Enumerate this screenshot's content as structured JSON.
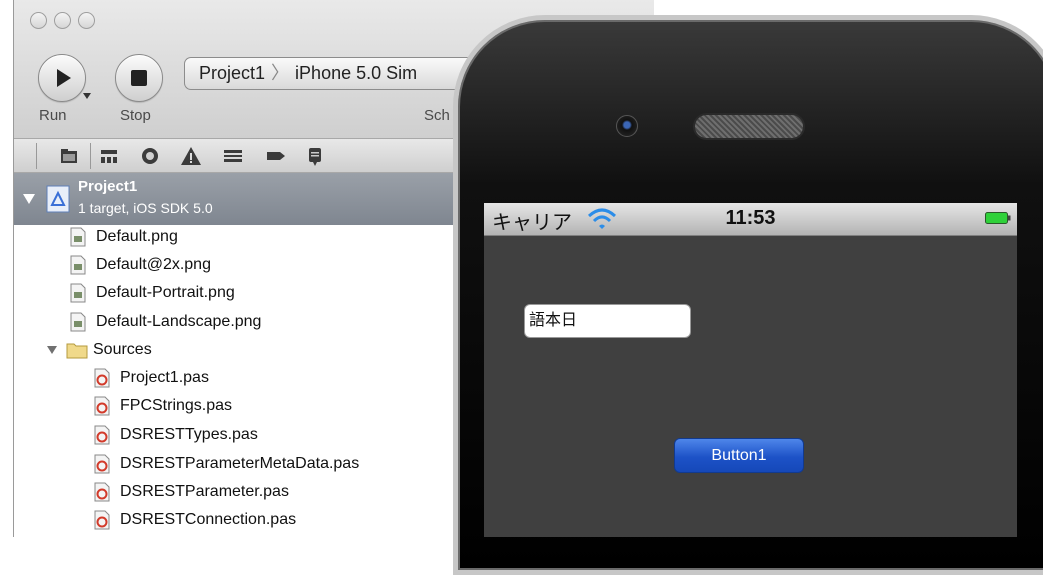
{
  "xcode": {
    "run_label": "Run",
    "stop_label": "Stop",
    "scheme": {
      "project": "Project1",
      "separator": "〉",
      "destination": "iPhone 5.0 Sim"
    },
    "scheme_label": "Sch",
    "navigator_icons": [
      "folder-icon",
      "hierarchy-icon",
      "search-icon",
      "warning-icon",
      "list-icon",
      "breakpoint-icon",
      "log-icon"
    ],
    "project": {
      "name": "Project1",
      "subtitle": "1 target, iOS SDK 5.0"
    },
    "files": [
      {
        "name": "Default.png",
        "icon": "image-file-icon"
      },
      {
        "name": "Default@2x.png",
        "icon": "image-file-icon"
      },
      {
        "name": "Default-Portrait.png",
        "icon": "image-file-icon"
      },
      {
        "name": "Default-Landscape.png",
        "icon": "image-file-icon"
      }
    ],
    "sources_folder": "Sources",
    "sources": [
      "Project1.pas",
      "FPCStrings.pas",
      "DSRESTTypes.pas",
      "DSRESTParameterMetaData.pas",
      "DSRESTParameter.pas",
      "DSRESTConnection.pas"
    ]
  },
  "simulator": {
    "carrier": "キャリア",
    "time": "11:53",
    "textfield_value": "語本日",
    "button_label": "Button1"
  },
  "colors": {
    "screen_bg": "#404040",
    "button_blue": "#1d52c7",
    "battery_green": "#2fd13a",
    "project_row": "#8a9099"
  }
}
